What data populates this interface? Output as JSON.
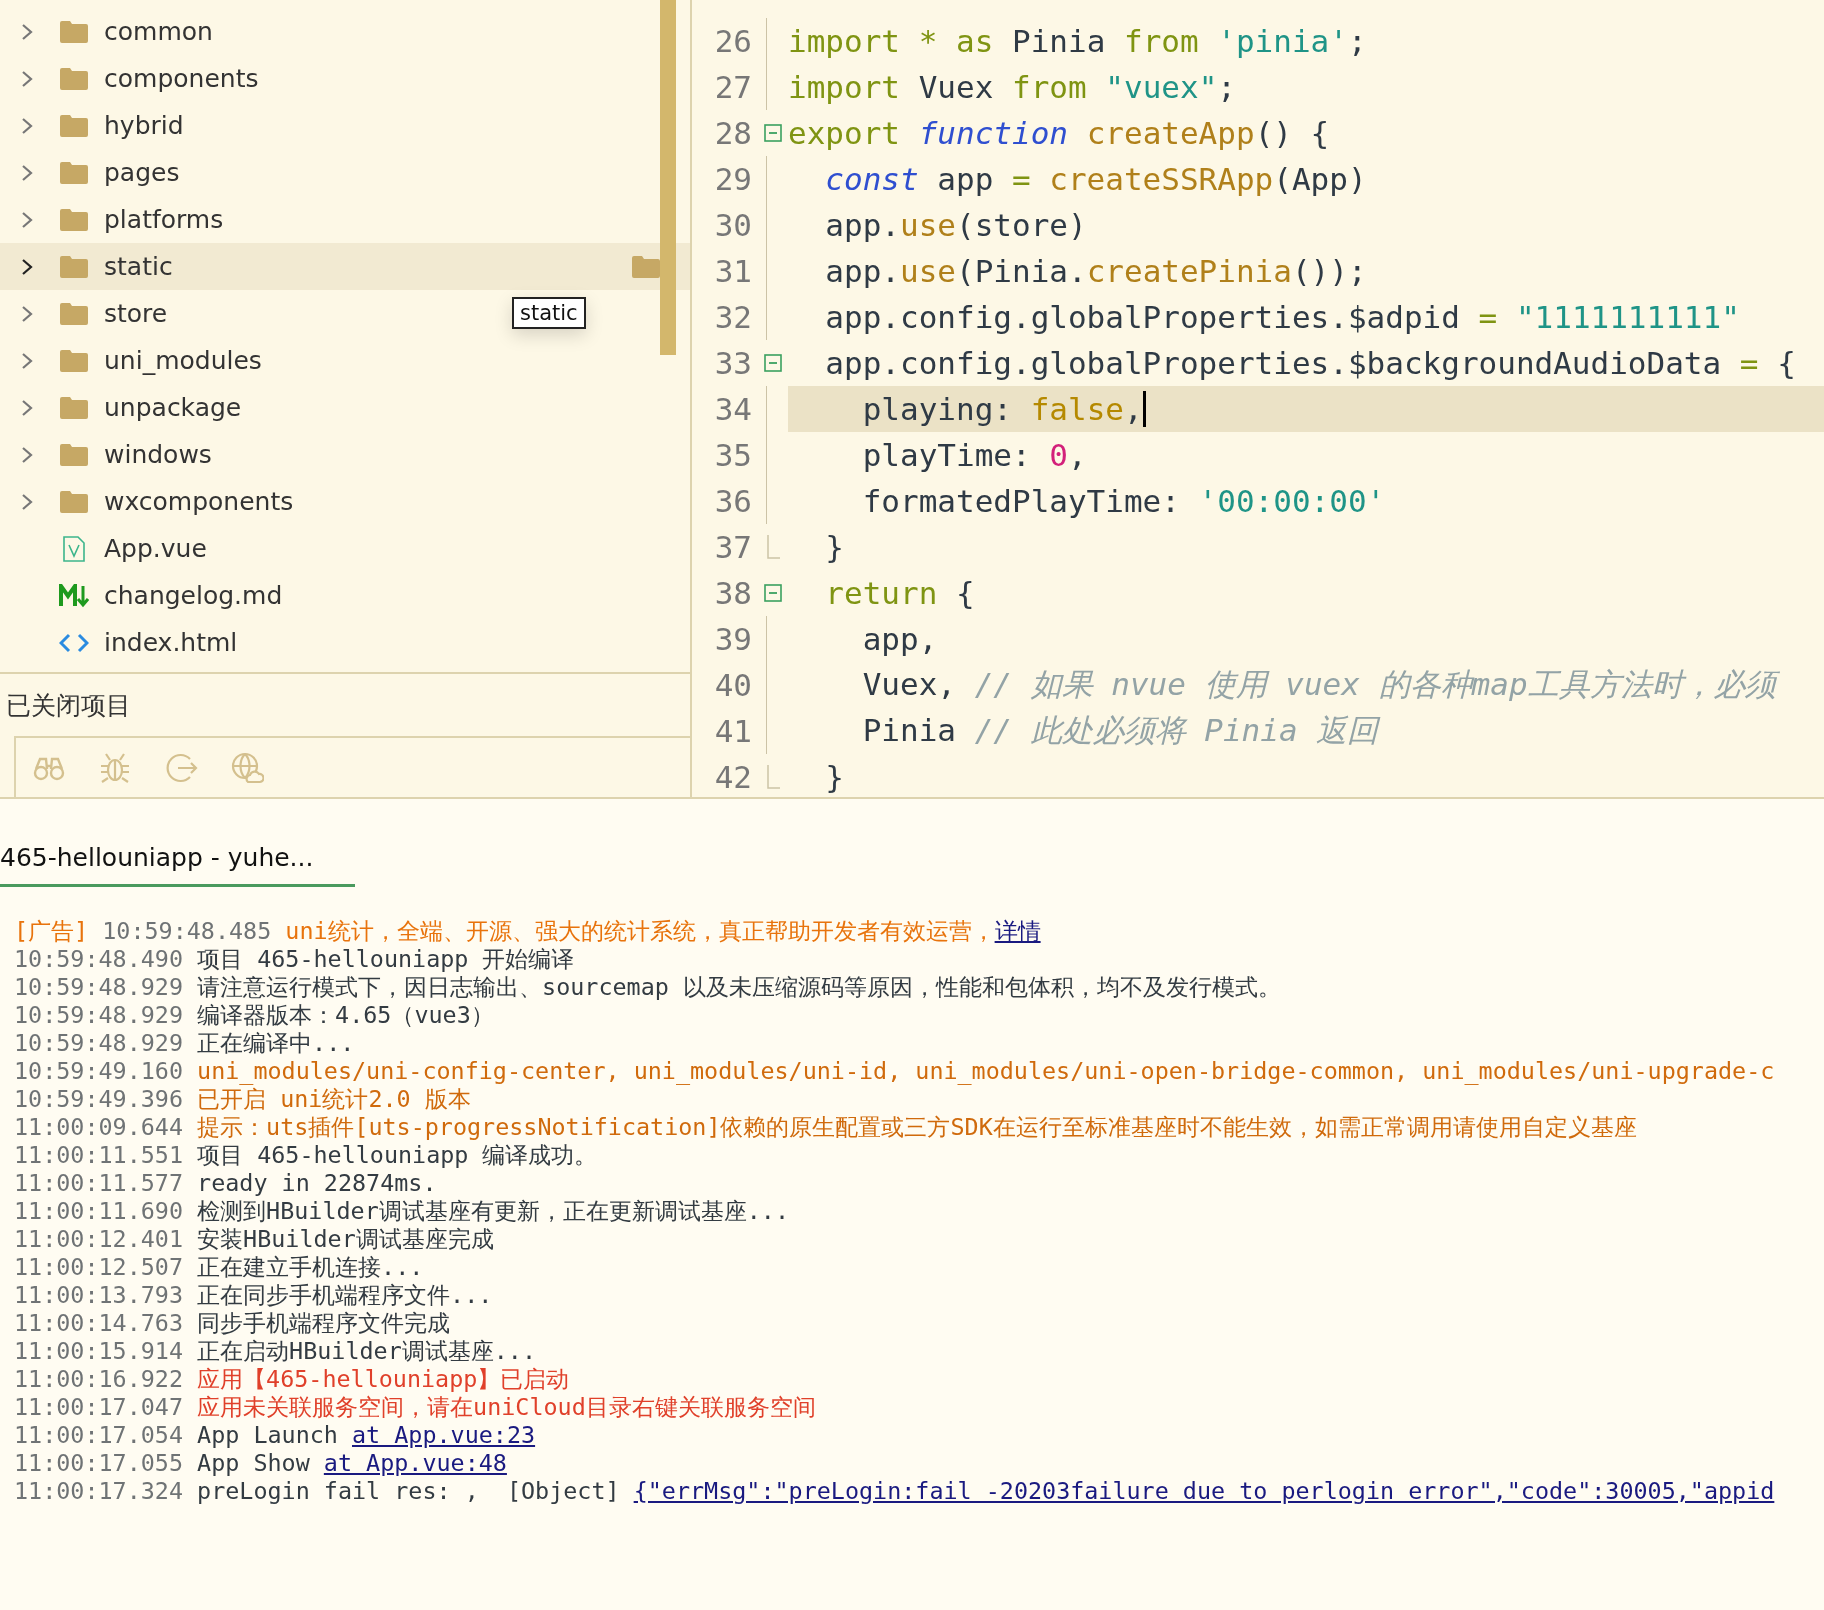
{
  "sidebar": {
    "items": [
      {
        "label": "common",
        "kind": "folder",
        "selected": false
      },
      {
        "label": "components",
        "kind": "folder",
        "selected": false
      },
      {
        "label": "hybrid",
        "kind": "folder",
        "selected": false
      },
      {
        "label": "pages",
        "kind": "folder",
        "selected": false
      },
      {
        "label": "platforms",
        "kind": "folder",
        "selected": false
      },
      {
        "label": "static",
        "kind": "folder",
        "selected": true
      },
      {
        "label": "store",
        "kind": "folder",
        "selected": false
      },
      {
        "label": "uni_modules",
        "kind": "folder",
        "selected": false
      },
      {
        "label": "unpackage",
        "kind": "folder",
        "selected": false
      },
      {
        "label": "windows",
        "kind": "folder",
        "selected": false
      },
      {
        "label": "wxcomponents",
        "kind": "folder",
        "selected": false
      },
      {
        "label": "App.vue",
        "kind": "vue",
        "selected": false
      },
      {
        "label": "changelog.md",
        "kind": "markdown",
        "selected": false
      },
      {
        "label": "index.html",
        "kind": "html",
        "selected": false
      }
    ],
    "tooltip": "static",
    "closed_projects": "已关闭项目"
  },
  "editor": {
    "lines": [
      {
        "number": "26",
        "kind": "plain",
        "tokens": [
          {
            "text": "import ",
            "kind": "kw"
          },
          {
            "text": "* ",
            "kind": "kw"
          },
          {
            "text": "as ",
            "kind": "kw"
          },
          {
            "text": "Pinia ",
            "kind": "plain"
          },
          {
            "text": "from ",
            "kind": "kw"
          },
          {
            "text": "'pinia'",
            "kind": "str"
          },
          {
            "text": ";",
            "kind": "plain"
          }
        ]
      },
      {
        "number": "27",
        "kind": "plain",
        "tokens": [
          {
            "text": "import ",
            "kind": "kw"
          },
          {
            "text": "Vuex ",
            "kind": "plain"
          },
          {
            "text": "from ",
            "kind": "kw"
          },
          {
            "text": "\"vuex\"",
            "kind": "str"
          },
          {
            "text": ";",
            "kind": "plain"
          }
        ]
      },
      {
        "number": "28",
        "kind": "foldstart",
        "tokens": [
          {
            "text": "export ",
            "kind": "kw"
          },
          {
            "text": "function ",
            "kind": "storage"
          },
          {
            "text": "createApp",
            "kind": "fn"
          },
          {
            "text": "() {",
            "kind": "plain"
          }
        ]
      },
      {
        "number": "29",
        "kind": "plain",
        "tokens": [
          {
            "text": "  const ",
            "kind": "storage"
          },
          {
            "text": "app ",
            "kind": "plain"
          },
          {
            "text": "= ",
            "kind": "kw"
          },
          {
            "text": "createSSRApp",
            "kind": "fn"
          },
          {
            "text": "(App)",
            "kind": "plain"
          }
        ]
      },
      {
        "number": "30",
        "kind": "plain",
        "tokens": [
          {
            "text": "  app.",
            "kind": "plain"
          },
          {
            "text": "use",
            "kind": "fn"
          },
          {
            "text": "(store)",
            "kind": "plain"
          }
        ]
      },
      {
        "number": "31",
        "kind": "plain",
        "tokens": [
          {
            "text": "  app.",
            "kind": "plain"
          },
          {
            "text": "use",
            "kind": "fn"
          },
          {
            "text": "(Pinia.",
            "kind": "plain"
          },
          {
            "text": "createPinia",
            "kind": "fn"
          },
          {
            "text": "());",
            "kind": "plain"
          }
        ]
      },
      {
        "number": "32",
        "kind": "plain",
        "tokens": [
          {
            "text": "  app.config.globalProperties.$adpid ",
            "kind": "plain"
          },
          {
            "text": "= ",
            "kind": "kw"
          },
          {
            "text": "\"1111111111\"",
            "kind": "str"
          }
        ]
      },
      {
        "number": "33",
        "kind": "foldstart",
        "tokens": [
          {
            "text": "  app.config.globalProperties.$backgroundAudioData ",
            "kind": "plain"
          },
          {
            "text": "= ",
            "kind": "kw"
          },
          {
            "text": "{",
            "kind": "plain"
          }
        ]
      },
      {
        "number": "34",
        "kind": "plain",
        "current": true,
        "tokens": [
          {
            "text": "    playing: ",
            "kind": "plain"
          },
          {
            "text": "false",
            "kind": "bool"
          },
          {
            "text": ",",
            "kind": "plain"
          }
        ]
      },
      {
        "number": "35",
        "kind": "plain",
        "tokens": [
          {
            "text": "    playTime: ",
            "kind": "plain"
          },
          {
            "text": "0",
            "kind": "num"
          },
          {
            "text": ",",
            "kind": "plain"
          }
        ]
      },
      {
        "number": "36",
        "kind": "plain",
        "tokens": [
          {
            "text": "    formatedPlayTime: ",
            "kind": "plain"
          },
          {
            "text": "'00:00:00'",
            "kind": "str"
          }
        ]
      },
      {
        "number": "37",
        "kind": "foldend",
        "tokens": [
          {
            "text": "  }",
            "kind": "plain"
          }
        ]
      },
      {
        "number": "38",
        "kind": "foldstart",
        "tokens": [
          {
            "text": "  return ",
            "kind": "kw"
          },
          {
            "text": "{",
            "kind": "plain"
          }
        ]
      },
      {
        "number": "39",
        "kind": "plain",
        "tokens": [
          {
            "text": "    app,",
            "kind": "plain"
          }
        ]
      },
      {
        "number": "40",
        "kind": "plain",
        "tokens": [
          {
            "text": "    Vuex, ",
            "kind": "plain"
          },
          {
            "text": "// 如果 nvue 使用 vuex 的各种map工具方法时，必须",
            "kind": "comment"
          }
        ]
      },
      {
        "number": "41",
        "kind": "plain",
        "tokens": [
          {
            "text": "    Pinia ",
            "kind": "plain"
          },
          {
            "text": "// 此处必须将 Pinia 返回",
            "kind": "comment"
          }
        ]
      },
      {
        "number": "42",
        "kind": "foldend",
        "tokens": [
          {
            "text": "  }",
            "kind": "plain"
          }
        ]
      }
    ]
  },
  "console": {
    "tabs": [
      {
        "label": "465-hellouniapp - yuhe...",
        "selected": true
      }
    ],
    "lines": [
      {
        "tag": "[广告]",
        "time": "10:59:48.485",
        "kind": "ad",
        "text": "uni统计，全端、开源、强大的统计系统，真正帮助开发者有效运营，",
        "link": "详情"
      },
      {
        "time": "10:59:48.490",
        "kind": "info",
        "text": "项目 465-hellouniapp 开始编译"
      },
      {
        "time": "10:59:48.929",
        "kind": "info",
        "text": "请注意运行模式下，因日志输出、sourcemap 以及未压缩源码等原因，性能和包体积，均不及发行模式。"
      },
      {
        "time": "10:59:48.929",
        "kind": "info",
        "text": "编译器版本：4.65（vue3）"
      },
      {
        "time": "10:59:48.929",
        "kind": "info",
        "text": "正在编译中..."
      },
      {
        "time": "10:59:49.160",
        "kind": "warn",
        "text": "uni_modules/uni-config-center, uni_modules/uni-id, uni_modules/uni-open-bridge-common, uni_modules/uni-upgrade-c"
      },
      {
        "time": "10:59:49.396",
        "kind": "warn",
        "text": "已开启 uni统计2.0 版本"
      },
      {
        "time": "11:00:09.644",
        "kind": "warn",
        "text": "提示：uts插件[uts-progressNotification]依赖的原生配置或三方SDK在运行至标准基座时不能生效，如需正常调用请使用自定义基座"
      },
      {
        "time": "11:00:11.551",
        "kind": "info",
        "text": "项目 465-hellouniapp 编译成功。"
      },
      {
        "time": "11:00:11.577",
        "kind": "info",
        "text": "ready in 22874ms."
      },
      {
        "time": "11:00:11.690",
        "kind": "info",
        "text": "检测到HBuilder调试基座有更新，正在更新调试基座..."
      },
      {
        "time": "11:00:12.401",
        "kind": "info",
        "text": "安装HBuilder调试基座完成"
      },
      {
        "time": "11:00:12.507",
        "kind": "info",
        "text": "正在建立手机连接..."
      },
      {
        "time": "11:00:13.793",
        "kind": "info",
        "text": "正在同步手机端程序文件..."
      },
      {
        "time": "11:00:14.763",
        "kind": "info",
        "text": "同步手机端程序文件完成"
      },
      {
        "time": "11:00:15.914",
        "kind": "info",
        "text": "正在启动HBuilder调试基座..."
      },
      {
        "time": "11:00:16.922",
        "kind": "error",
        "text": "应用【465-hellouniapp】已启动"
      },
      {
        "time": "11:00:17.047",
        "kind": "error",
        "text": "应用未关联服务空间，请在uniCloud目录右键关联服务空间"
      },
      {
        "time": "11:00:17.054",
        "kind": "info",
        "text": "App Launch ",
        "link": "at App.vue:23"
      },
      {
        "time": "11:00:17.055",
        "kind": "info",
        "text": "App Show ",
        "link": "at App.vue:48"
      },
      {
        "time": "11:00:17.324",
        "kind": "info",
        "text": "preLogin fail res: ,  [Object] ",
        "link": "{\"errMsg\":\"preLogin:fail -20203failure due to perlogin error\",\"code\":30005,\"appid"
      }
    ]
  }
}
